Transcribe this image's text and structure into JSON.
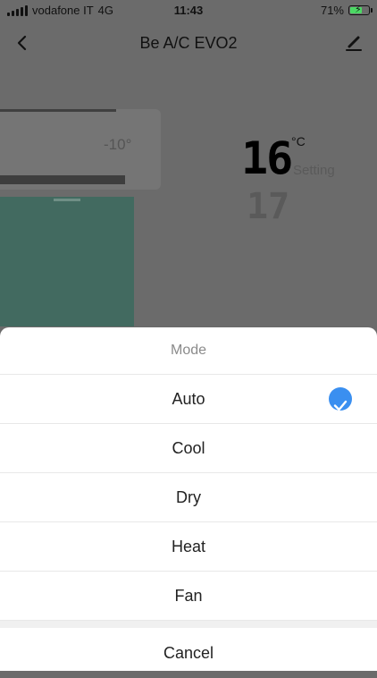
{
  "status_bar": {
    "carrier": "vodafone IT",
    "network": "4G",
    "time": "11:43",
    "battery_percent": "71%",
    "battery_level": 0.71,
    "battery_color": "#4cd964"
  },
  "header": {
    "title": "Be A/C EVO2",
    "back_icon": "chevron-left-icon",
    "edit_icon": "pencil-icon"
  },
  "ac_panel": {
    "unit_display": "-10°",
    "current_temp": "16",
    "temp_unit": "°C",
    "setting_label": "Setting",
    "setting_temp": "17"
  },
  "mode_sheet": {
    "title": "Mode",
    "options": [
      {
        "label": "Auto",
        "selected": true
      },
      {
        "label": "Cool",
        "selected": false
      },
      {
        "label": "Dry",
        "selected": false
      },
      {
        "label": "Heat",
        "selected": false
      },
      {
        "label": "Fan",
        "selected": false
      }
    ],
    "cancel_label": "Cancel",
    "accent_color": "#3a8ff0"
  }
}
